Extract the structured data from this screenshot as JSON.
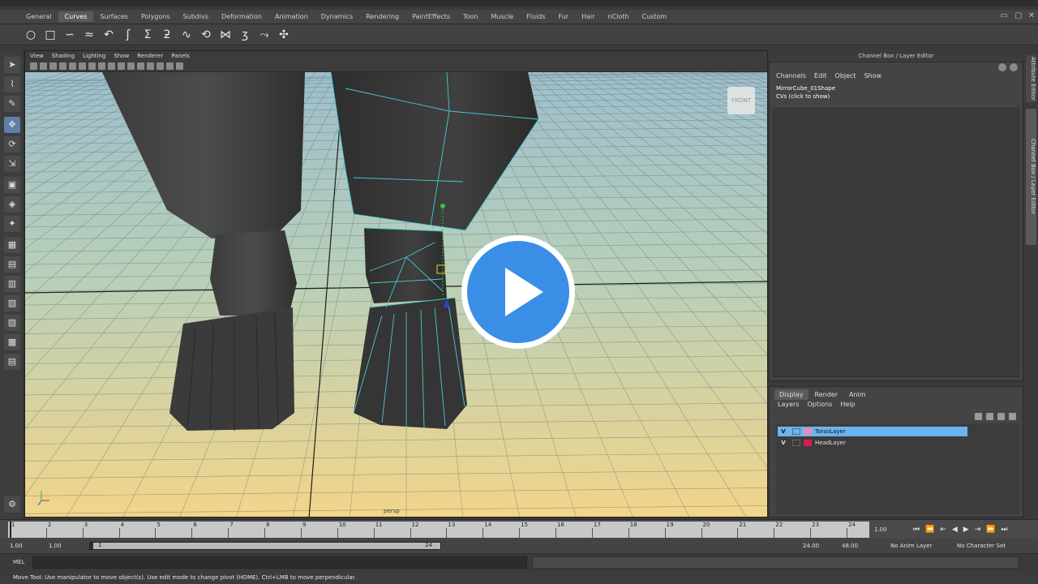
{
  "menu_tabs": [
    "General",
    "Curves",
    "Surfaces",
    "Polygons",
    "Subdivs",
    "Deformation",
    "Animation",
    "Dynamics",
    "Rendering",
    "PaintEffects",
    "Toon",
    "Muscle",
    "Fluids",
    "Fur",
    "Hair",
    "nCloth",
    "Custom"
  ],
  "active_tab_index": 1,
  "viewport": {
    "menu": [
      "View",
      "Shading",
      "Lighting",
      "Show",
      "Renderer",
      "Panels"
    ],
    "camera_label": "persp",
    "view_cube_label": "FRONT"
  },
  "channel_box": {
    "title": "Channel Box / Layer Editor",
    "menu": [
      "Channels",
      "Edit",
      "Object",
      "Show"
    ],
    "node_name": "MirrorCube_01Shape",
    "cvs_label": "CVs (click to show)"
  },
  "side_tabs": [
    "Attribute Editor",
    "Channel Box / Layer Editor"
  ],
  "layer_editor": {
    "tabs": [
      "Display",
      "Render",
      "Anim"
    ],
    "active_tab_index": 0,
    "menu": [
      "Layers",
      "Options",
      "Help"
    ],
    "layers": [
      {
        "visible": "V",
        "name": "TorsoLayer",
        "color": "#f08ab0",
        "selected": true
      },
      {
        "visible": "V",
        "name": "HeadLayer",
        "color": "#d81e4a",
        "selected": false
      }
    ]
  },
  "timeline": {
    "ticks": [
      "1",
      "2",
      "3",
      "4",
      "5",
      "6",
      "7",
      "8",
      "9",
      "10",
      "11",
      "12",
      "13",
      "14",
      "15",
      "16",
      "17",
      "18",
      "19",
      "20",
      "21",
      "22",
      "23",
      "24"
    ],
    "current_frame": "1.00"
  },
  "range": {
    "start": "1.00",
    "playback_start": "1.00",
    "slider_start": "1",
    "slider_end": "24",
    "playback_end": "24.00",
    "end": "48.00",
    "anim_layer": "No Anim Layer",
    "character_set": "No Character Set"
  },
  "command_line": {
    "label": "MEL"
  },
  "help_line": "Move Tool: Use manipulator to move object(s). Use edit mode to change pivot (HOME). Ctrl+LMB to move perpendicular.",
  "colors": {
    "selection_highlight": "#6ab4f0",
    "play_button": "#3a8ee6"
  }
}
